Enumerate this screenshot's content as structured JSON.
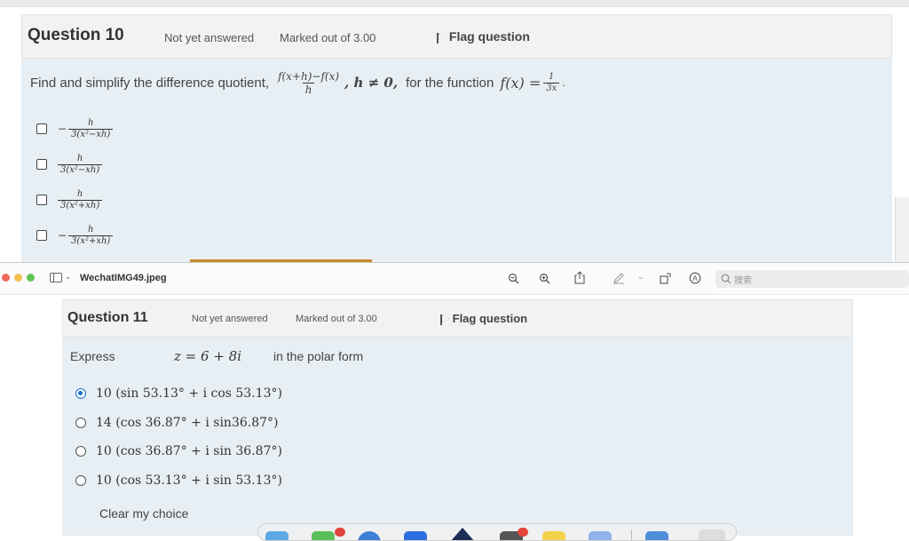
{
  "top_question": {
    "title": "Question 10",
    "status": "Not yet answered",
    "marks": "Marked out of 3.00",
    "flag_label": "Flag question",
    "prompt_lead": "Find and simplify the difference quotient,",
    "quotient_num": "f(x+h)−f(x)",
    "quotient_den": "h",
    "condition": ", h ≠ 0,",
    "prompt_mid": "for the function",
    "function_lhs": "f(x) =",
    "function_num": "1",
    "function_den": "3x",
    "options": [
      {
        "sign": "−",
        "num": "h",
        "den": "3(x²−xh)"
      },
      {
        "sign": "",
        "num": "h",
        "den": "3(x²−xh)"
      },
      {
        "sign": "",
        "num": "h",
        "den": "3(x²+xh)"
      },
      {
        "sign": "−",
        "num": "h",
        "den": "3(x²+xh)"
      }
    ]
  },
  "viewer": {
    "filename": "WechatIMG49.jpeg",
    "search_placeholder": "搜索",
    "colors": {
      "close": "#ed6a5e",
      "minimize": "#f5bf4f",
      "zoom": "#61c554"
    }
  },
  "bottom_question": {
    "title": "Question 11",
    "status": "Not yet answered",
    "marks": "Marked out of 3.00",
    "flag_label": "Flag question",
    "prompt_lead": "Express",
    "expression": "z = 6 + 8i",
    "prompt_tail": "in the polar form",
    "options": [
      {
        "text": "10 (sin 53.13° + i cos 53.13°)",
        "selected": true
      },
      {
        "text": "14 (cos 36.87° + i sin36.87°)",
        "selected": false
      },
      {
        "text": "10 (cos 36.87° + i sin 36.87°)",
        "selected": false
      },
      {
        "text": "10 (cos 53.13° + i sin 53.13°)",
        "selected": false
      }
    ],
    "clear_label": "Clear my choice"
  },
  "colors": {
    "panel_bg": "#e7eff4",
    "header_bg": "#f2f2f2",
    "accent": "#1a6fd6"
  }
}
